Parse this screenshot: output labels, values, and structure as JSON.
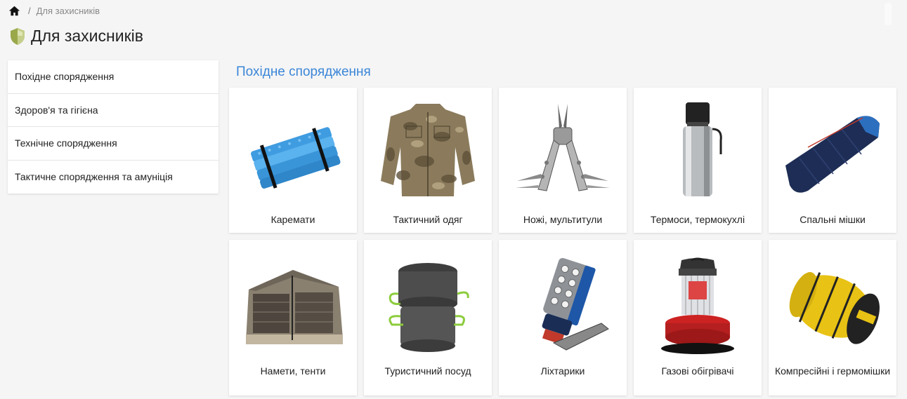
{
  "breadcrumb": {
    "home_icon": "home-icon",
    "separator": "/",
    "current": "Для захисників"
  },
  "page": {
    "title": "Для захисників",
    "title_icon": "shield-icon",
    "title_icon_color": "#9aa84a"
  },
  "sidebar": {
    "items": [
      {
        "label": "Похідне спорядження"
      },
      {
        "label": "Здоров'я та гігієна"
      },
      {
        "label": "Технічне спорядження"
      },
      {
        "label": "Тактичне спорядження та амуніція"
      }
    ]
  },
  "section": {
    "title": "Похідне спорядження",
    "title_color": "#3b86d8"
  },
  "categories": [
    {
      "label": "Каремати",
      "image": "foam-mat-image"
    },
    {
      "label": "Тактичний одяг",
      "image": "camo-jacket-image"
    },
    {
      "label": "Ножі, мультитули",
      "image": "multitool-image"
    },
    {
      "label": "Термоси, термокухлі",
      "image": "thermos-image"
    },
    {
      "label": "Спальні мішки",
      "image": "sleeping-bag-image"
    },
    {
      "label": "Намети, тенти",
      "image": "tent-image"
    },
    {
      "label": "Туристичний посуд",
      "image": "cookware-image"
    },
    {
      "label": "Ліхтарики",
      "image": "flashlight-image"
    },
    {
      "label": "Газові обігрівачі",
      "image": "heater-image"
    },
    {
      "label": "Компресійні і гермомішки",
      "image": "compression-bag-image"
    }
  ]
}
